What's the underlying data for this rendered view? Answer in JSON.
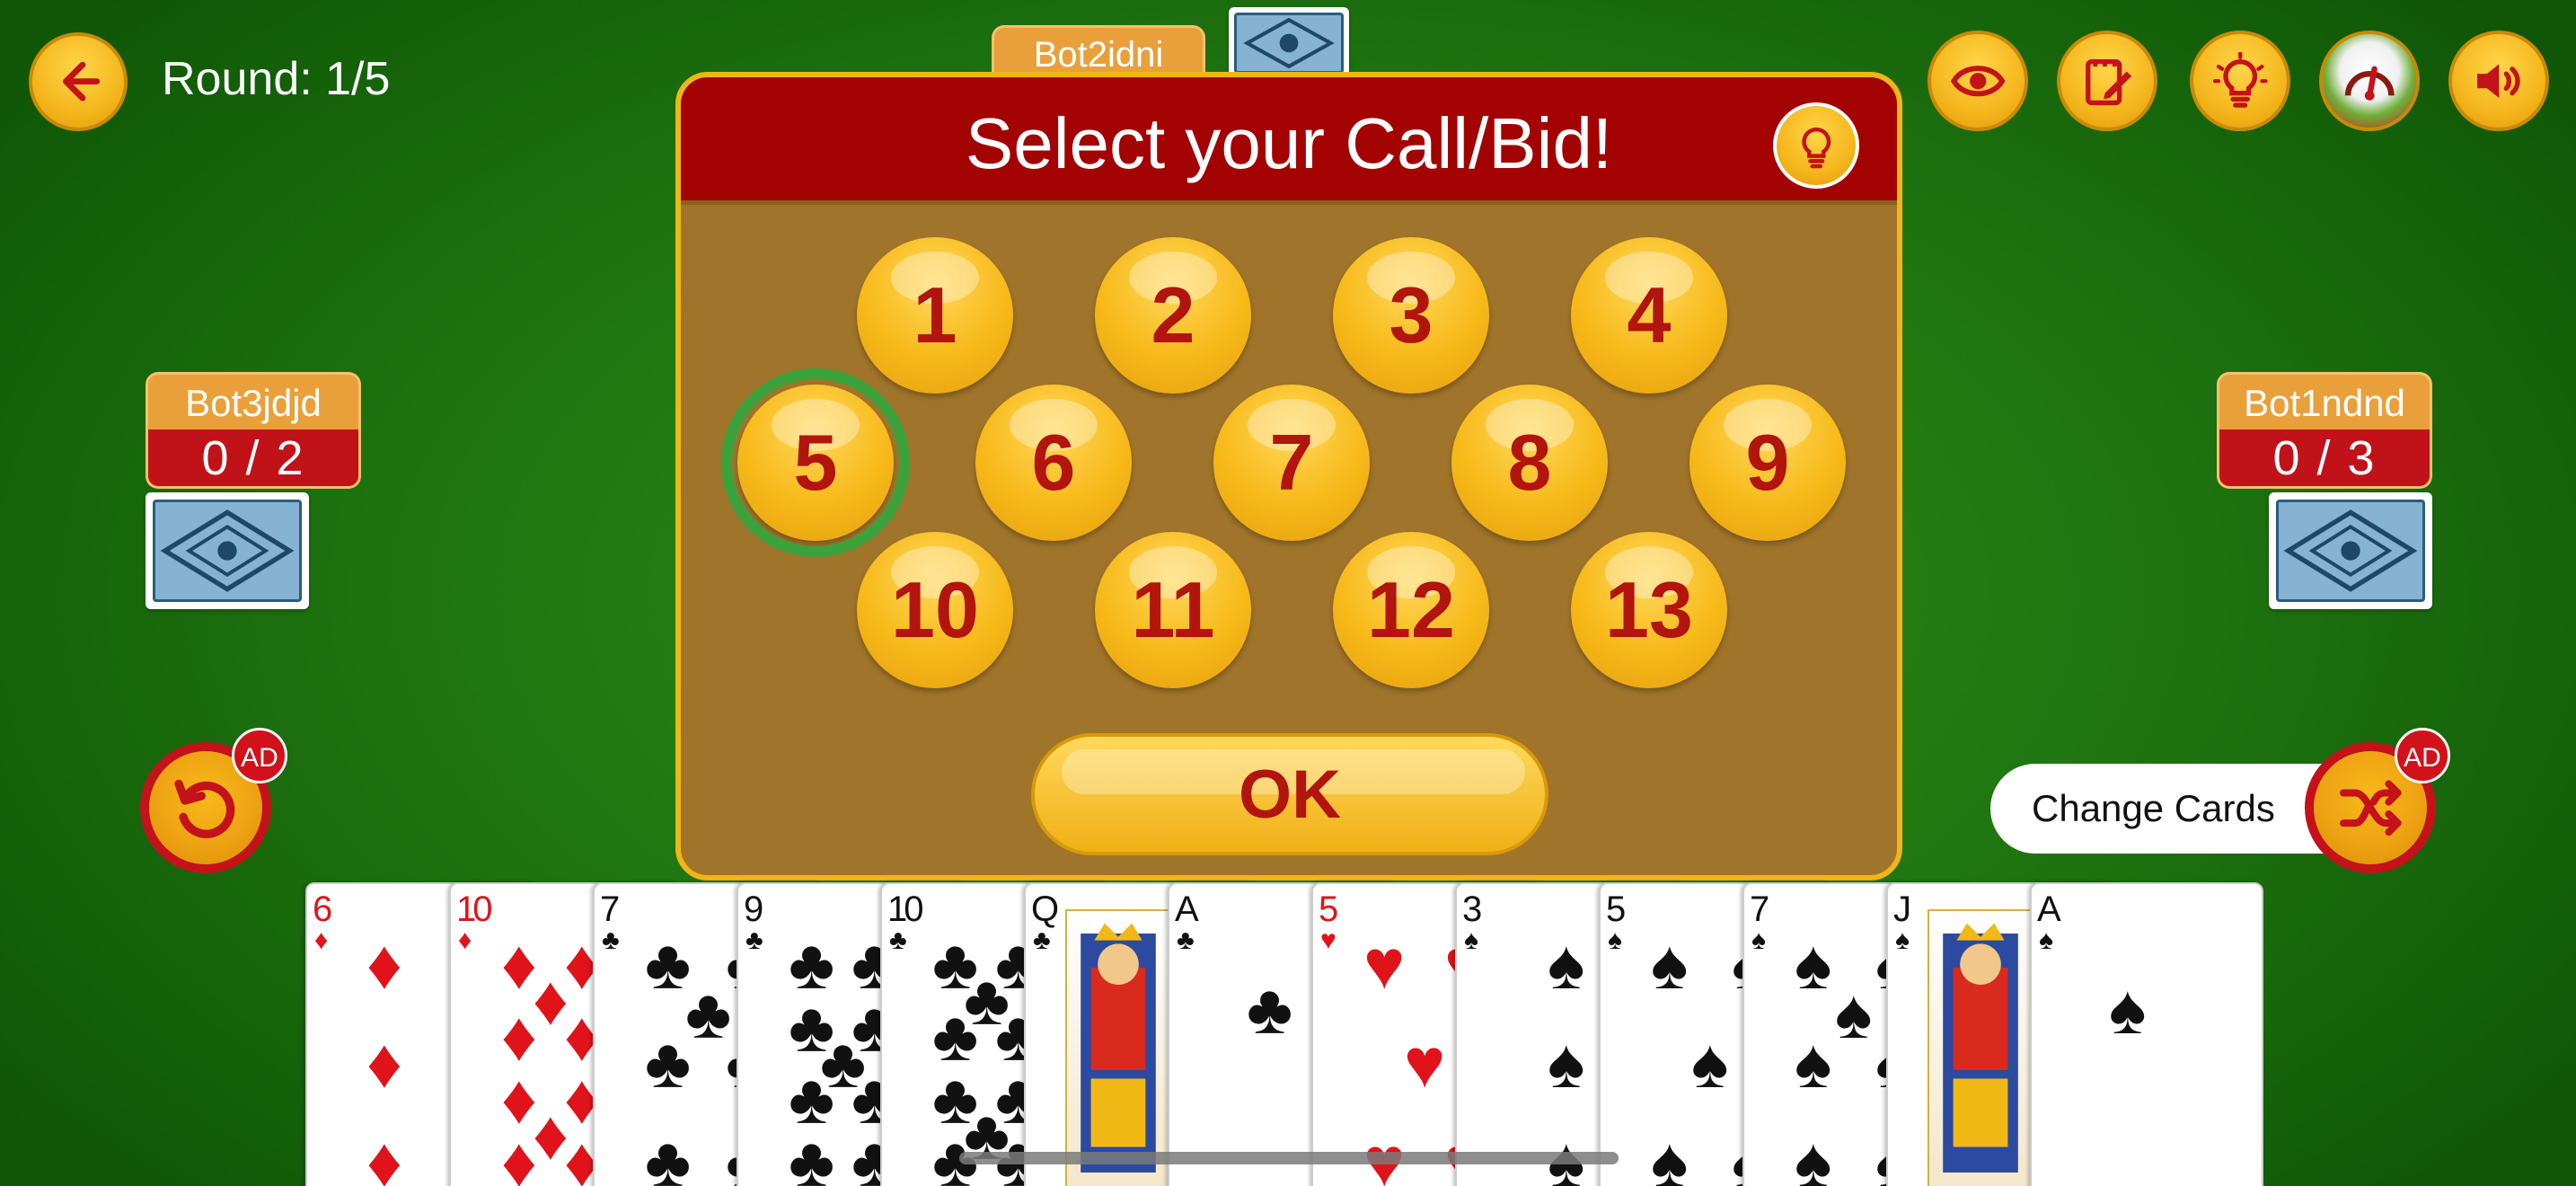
{
  "header": {
    "back_icon": "arrow-left-icon",
    "round_text": "Round: 1/5"
  },
  "players": {
    "top": {
      "name": "Bot2idni"
    },
    "left": {
      "name": "Bot3jdjd",
      "score": "0 / 2"
    },
    "right": {
      "name": "Bot1ndnd",
      "score": "0 / 3"
    }
  },
  "toolbar": {
    "icons": [
      "eye-icon",
      "notepad-edit-icon",
      "lightbulb-icon",
      "speedometer-icon",
      "speaker-icon"
    ]
  },
  "dialog": {
    "title": "Select your Call/Bid!",
    "hint_icon": "lightbulb-icon",
    "bids": [
      "1",
      "2",
      "3",
      "4",
      "5",
      "6",
      "7",
      "8",
      "9",
      "10",
      "11",
      "12",
      "13"
    ],
    "selected_bid": "5",
    "ok_label": "OK"
  },
  "actions": {
    "undo_ad_label": "AD",
    "shuffle_ad_label": "AD",
    "change_cards_label": "Change Cards"
  },
  "hand": [
    {
      "rank": "6",
      "suit": "♦",
      "color": "red"
    },
    {
      "rank": "10",
      "suit": "♦",
      "color": "red"
    },
    {
      "rank": "7",
      "suit": "♣",
      "color": "black"
    },
    {
      "rank": "9",
      "suit": "♣",
      "color": "black"
    },
    {
      "rank": "10",
      "suit": "♣",
      "color": "black"
    },
    {
      "rank": "Q",
      "suit": "♣",
      "color": "black"
    },
    {
      "rank": "A",
      "suit": "♣",
      "color": "black"
    },
    {
      "rank": "5",
      "suit": "♥",
      "color": "red"
    },
    {
      "rank": "3",
      "suit": "♠",
      "color": "black"
    },
    {
      "rank": "5",
      "suit": "♠",
      "color": "black"
    },
    {
      "rank": "7",
      "suit": "♠",
      "color": "black"
    },
    {
      "rank": "J",
      "suit": "♠",
      "color": "black"
    },
    {
      "rank": "A",
      "suit": "♠",
      "color": "black"
    }
  ]
}
